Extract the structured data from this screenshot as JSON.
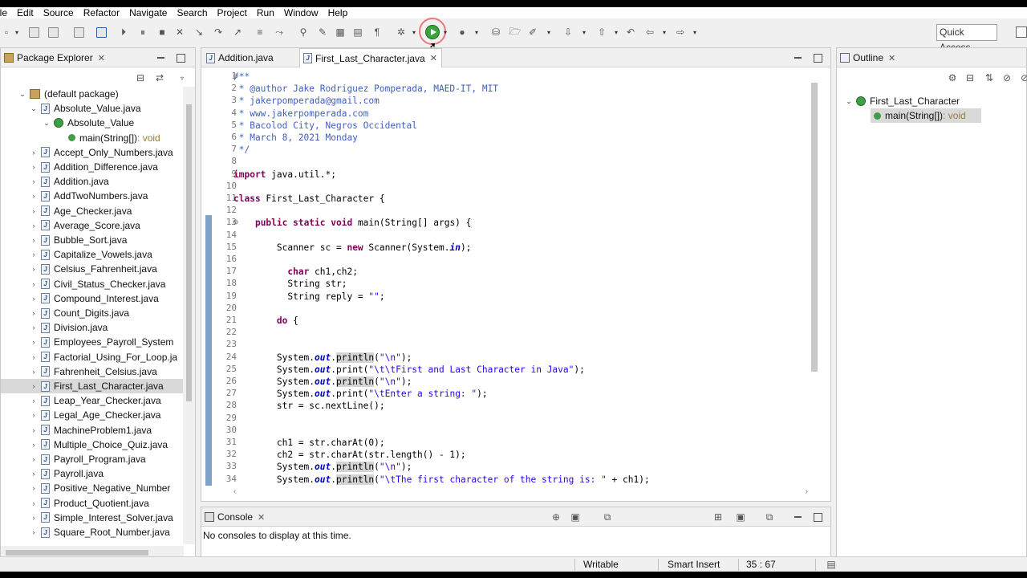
{
  "menu": [
    "ile",
    "Edit",
    "Source",
    "Refactor",
    "Navigate",
    "Search",
    "Project",
    "Run",
    "Window",
    "Help"
  ],
  "toolbar": {
    "quick_access": "Quick Access"
  },
  "package_explorer": {
    "title": "Package Explorer",
    "items": [
      {
        "label": "(default package)",
        "kind": "package",
        "level": 1,
        "tw": "open"
      },
      {
        "label": "Absolute_Value.java",
        "kind": "java",
        "level": 2,
        "tw": "open"
      },
      {
        "label": "Absolute_Value",
        "kind": "class",
        "level": 3,
        "tw": "open"
      },
      {
        "label": "main(String[])",
        "suffix": " : void",
        "kind": "method",
        "level": 4,
        "tw": ""
      },
      {
        "label": "Accept_Only_Numbers.java",
        "kind": "java",
        "level": 2,
        "tw": "closed"
      },
      {
        "label": "Addition_Difference.java",
        "kind": "java",
        "level": 2,
        "tw": "closed"
      },
      {
        "label": "Addition.java",
        "kind": "java",
        "level": 2,
        "tw": "closed"
      },
      {
        "label": "AddTwoNumbers.java",
        "kind": "java",
        "level": 2,
        "tw": "closed"
      },
      {
        "label": "Age_Checker.java",
        "kind": "java",
        "level": 2,
        "tw": "closed"
      },
      {
        "label": "Average_Score.java",
        "kind": "java",
        "level": 2,
        "tw": "closed"
      },
      {
        "label": "Bubble_Sort.java",
        "kind": "java",
        "level": 2,
        "tw": "closed"
      },
      {
        "label": "Capitalize_Vowels.java",
        "kind": "java",
        "level": 2,
        "tw": "closed"
      },
      {
        "label": "Celsius_Fahrenheit.java",
        "kind": "java",
        "level": 2,
        "tw": "closed"
      },
      {
        "label": "Civil_Status_Checker.java",
        "kind": "java",
        "level": 2,
        "tw": "closed"
      },
      {
        "label": "Compound_Interest.java",
        "kind": "java",
        "level": 2,
        "tw": "closed"
      },
      {
        "label": "Count_Digits.java",
        "kind": "java",
        "level": 2,
        "tw": "closed"
      },
      {
        "label": "Division.java",
        "kind": "java",
        "level": 2,
        "tw": "closed"
      },
      {
        "label": "Employees_Payroll_System",
        "kind": "java",
        "level": 2,
        "tw": "closed"
      },
      {
        "label": "Factorial_Using_For_Loop.ja",
        "kind": "java",
        "level": 2,
        "tw": "closed"
      },
      {
        "label": "Fahrenheit_Celsius.java",
        "kind": "java",
        "level": 2,
        "tw": "closed"
      },
      {
        "label": "First_Last_Character.java",
        "kind": "java",
        "level": 2,
        "tw": "closed",
        "selected": true
      },
      {
        "label": "Leap_Year_Checker.java",
        "kind": "java",
        "level": 2,
        "tw": "closed"
      },
      {
        "label": "Legal_Age_Checker.java",
        "kind": "java",
        "level": 2,
        "tw": "closed"
      },
      {
        "label": "MachineProblem1.java",
        "kind": "java",
        "level": 2,
        "tw": "closed"
      },
      {
        "label": "Multiple_Choice_Quiz.java",
        "kind": "java",
        "level": 2,
        "tw": "closed"
      },
      {
        "label": "Payroll_Program.java",
        "kind": "java",
        "level": 2,
        "tw": "closed"
      },
      {
        "label": "Payroll.java",
        "kind": "java",
        "level": 2,
        "tw": "closed"
      },
      {
        "label": "Positive_Negative_Number",
        "kind": "java",
        "level": 2,
        "tw": "closed"
      },
      {
        "label": "Product_Quotient.java",
        "kind": "java",
        "level": 2,
        "tw": "closed"
      },
      {
        "label": "Simple_Interest_Solver.java",
        "kind": "java",
        "level": 2,
        "tw": "closed"
      },
      {
        "label": "Square_Root_Number.java",
        "kind": "java",
        "level": 2,
        "tw": "closed"
      }
    ]
  },
  "editor": {
    "tabs": [
      "Addition.java",
      "First_Last_Character.java"
    ],
    "lines": [
      {
        "n": "1",
        "marker": "⊖",
        "parts": [
          [
            "c",
            "/**"
          ]
        ]
      },
      {
        "n": "2",
        "parts": [
          [
            "c",
            " * @author Jake Rodriguez Pomperada, MAED-IT, MIT"
          ]
        ]
      },
      {
        "n": "3",
        "parts": [
          [
            "c",
            " * jakerpomperada@gmail.com"
          ]
        ]
      },
      {
        "n": "4",
        "parts": [
          [
            "c",
            " * www.jakerpomperada.com"
          ]
        ]
      },
      {
        "n": "5",
        "parts": [
          [
            "c",
            " * Bacolod City, Negros Occidental"
          ]
        ]
      },
      {
        "n": "6",
        "parts": [
          [
            "c",
            " * March 8, 2021 Monday"
          ]
        ]
      },
      {
        "n": "7",
        "parts": [
          [
            "c",
            " */"
          ]
        ]
      },
      {
        "n": "8",
        "parts": []
      },
      {
        "n": "9",
        "parts": [
          [
            "k",
            "import"
          ],
          [
            "t",
            " java.util.*;"
          ]
        ]
      },
      {
        "n": "10",
        "parts": []
      },
      {
        "n": "11",
        "parts": [
          [
            "k",
            "class"
          ],
          [
            "t",
            " First_Last_Character {"
          ]
        ]
      },
      {
        "n": "12",
        "parts": []
      },
      {
        "n": "13",
        "marker": "⊖",
        "parts": [
          [
            "t",
            "    "
          ],
          [
            "k",
            "public static void"
          ],
          [
            "t",
            " main(String[] args) {"
          ]
        ]
      },
      {
        "n": "14",
        "parts": []
      },
      {
        "n": "15",
        "parts": [
          [
            "t",
            "        Scanner sc = "
          ],
          [
            "k",
            "new"
          ],
          [
            "t",
            " Scanner(System."
          ],
          [
            "f",
            "in"
          ],
          [
            "t",
            ");"
          ]
        ]
      },
      {
        "n": "16",
        "parts": []
      },
      {
        "n": "17",
        "parts": [
          [
            "t",
            "          "
          ],
          [
            "k",
            "char"
          ],
          [
            "t",
            " ch1,ch2;"
          ]
        ]
      },
      {
        "n": "18",
        "parts": [
          [
            "t",
            "          String str;"
          ]
        ]
      },
      {
        "n": "19",
        "parts": [
          [
            "t",
            "          String reply = "
          ],
          [
            "s",
            "\"\""
          ],
          [
            "t",
            ";"
          ]
        ]
      },
      {
        "n": "20",
        "parts": []
      },
      {
        "n": "21",
        "parts": [
          [
            "t",
            "        "
          ],
          [
            "k",
            "do"
          ],
          [
            "t",
            " {"
          ]
        ]
      },
      {
        "n": "22",
        "parts": []
      },
      {
        "n": "23",
        "parts": []
      },
      {
        "n": "24",
        "parts": [
          [
            "t",
            "        System."
          ],
          [
            "f",
            "out"
          ],
          [
            "t",
            "."
          ],
          [
            "h",
            "println"
          ],
          [
            "t",
            "("
          ],
          [
            "s",
            "\"\\n\""
          ],
          [
            "t",
            ");"
          ]
        ]
      },
      {
        "n": "25",
        "parts": [
          [
            "t",
            "        System."
          ],
          [
            "f",
            "out"
          ],
          [
            "t",
            ".print("
          ],
          [
            "s",
            "\"\\t\\tFirst and Last Character in Java\""
          ],
          [
            "t",
            ");"
          ]
        ]
      },
      {
        "n": "26",
        "parts": [
          [
            "t",
            "        System."
          ],
          [
            "f",
            "out"
          ],
          [
            "t",
            "."
          ],
          [
            "h",
            "println"
          ],
          [
            "t",
            "("
          ],
          [
            "s",
            "\"\\n\""
          ],
          [
            "t",
            ");"
          ]
        ]
      },
      {
        "n": "27",
        "parts": [
          [
            "t",
            "        System."
          ],
          [
            "f",
            "out"
          ],
          [
            "t",
            ".print("
          ],
          [
            "s",
            "\"\\tEnter a string: \""
          ],
          [
            "t",
            ");"
          ]
        ]
      },
      {
        "n": "28",
        "parts": [
          [
            "t",
            "        str = sc.nextLine();"
          ]
        ]
      },
      {
        "n": "29",
        "parts": []
      },
      {
        "n": "30",
        "parts": []
      },
      {
        "n": "31",
        "parts": [
          [
            "t",
            "        ch1 = str.charAt(0);"
          ]
        ]
      },
      {
        "n": "32",
        "parts": [
          [
            "t",
            "        ch2 = str.charAt(str.length() - 1);"
          ]
        ]
      },
      {
        "n": "33",
        "parts": [
          [
            "t",
            "        System."
          ],
          [
            "f",
            "out"
          ],
          [
            "t",
            "."
          ],
          [
            "h",
            "println"
          ],
          [
            "t",
            "("
          ],
          [
            "s",
            "\"\\n\""
          ],
          [
            "t",
            ");"
          ]
        ]
      },
      {
        "n": "34",
        "parts": [
          [
            "t",
            "        System."
          ],
          [
            "f",
            "out"
          ],
          [
            "t",
            "."
          ],
          [
            "h",
            "println"
          ],
          [
            "t",
            "("
          ],
          [
            "s",
            "\"\\tThe first character of the string is: \""
          ],
          [
            "t",
            " + ch1);"
          ]
        ]
      }
    ]
  },
  "outline": {
    "title": "Outline",
    "class_name": "First_Last_Character",
    "method": "main(String[])",
    "method_suffix": " : void"
  },
  "console": {
    "title": "Console",
    "message": "No consoles to display at this time."
  },
  "status": {
    "writable": "Writable",
    "insert_mode": "Smart Insert",
    "position": "35 : 67"
  },
  "colors": {
    "comment": "#3f5fbf",
    "keyword": "#7f0055",
    "string": "#2a00ff",
    "field": "#0000c0",
    "run_green": "#3aa53a",
    "highlight_circle": "#e67a7a"
  }
}
